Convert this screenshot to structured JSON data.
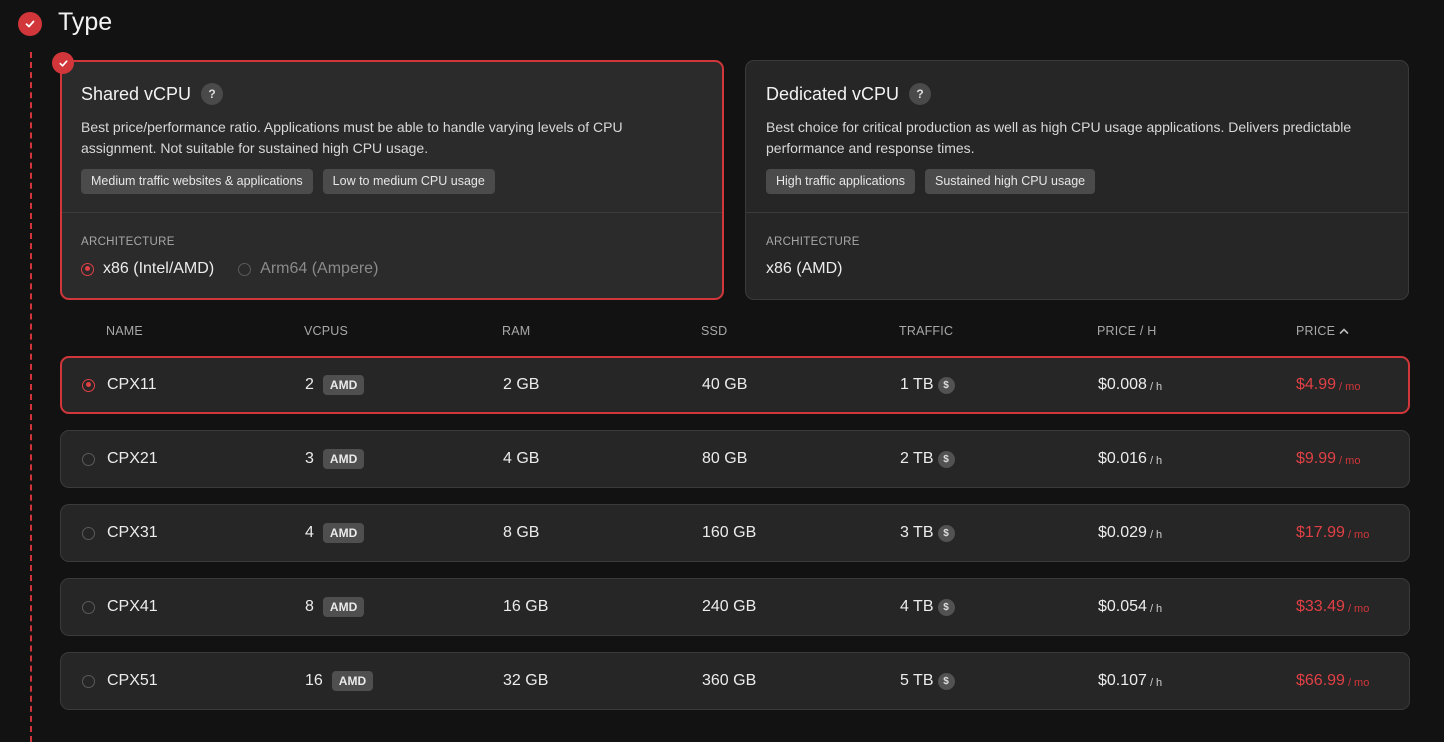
{
  "section": {
    "title": "Type"
  },
  "cards": {
    "shared": {
      "title": "Shared vCPU",
      "help": "?",
      "description": "Best price/performance ratio. Applications must be able to handle varying levels of CPU assignment. Not suitable for sustained high CPU usage.",
      "tags": [
        "Medium traffic websites & applications",
        "Low to medium CPU usage"
      ],
      "arch_label": "ARCHITECTURE",
      "arch_options": [
        {
          "label": "x86 (Intel/AMD)",
          "selected": true
        },
        {
          "label": "Arm64 (Ampere)",
          "selected": false
        }
      ]
    },
    "dedicated": {
      "title": "Dedicated vCPU",
      "help": "?",
      "description": "Best choice for critical production as well as high CPU usage applications. Delivers predictable performance and response times.",
      "tags": [
        "High traffic applications",
        "Sustained high CPU usage"
      ],
      "arch_label": "ARCHITECTURE",
      "arch_value": "x86 (AMD)"
    }
  },
  "table": {
    "headers": [
      "NAME",
      "VCPUS",
      "RAM",
      "SSD",
      "TRAFFIC",
      "PRICE / H",
      "PRICE"
    ],
    "sort_column": "PRICE",
    "rows": [
      {
        "name": "CPX11",
        "vcpus": "2",
        "badge": "AMD",
        "ram": "2 GB",
        "ssd": "40 GB",
        "traffic": "1 TB",
        "price_h": "$0.008",
        "price_h_unit": "/ h",
        "price": "$4.99",
        "price_unit": "/ mo",
        "selected": true
      },
      {
        "name": "CPX21",
        "vcpus": "3",
        "badge": "AMD",
        "ram": "4 GB",
        "ssd": "80 GB",
        "traffic": "2 TB",
        "price_h": "$0.016",
        "price_h_unit": "/ h",
        "price": "$9.99",
        "price_unit": "/ mo",
        "selected": false
      },
      {
        "name": "CPX31",
        "vcpus": "4",
        "badge": "AMD",
        "ram": "8 GB",
        "ssd": "160 GB",
        "traffic": "3 TB",
        "price_h": "$0.029",
        "price_h_unit": "/ h",
        "price": "$17.99",
        "price_unit": "/ mo",
        "selected": false
      },
      {
        "name": "CPX41",
        "vcpus": "8",
        "badge": "AMD",
        "ram": "16 GB",
        "ssd": "240 GB",
        "traffic": "4 TB",
        "price_h": "$0.054",
        "price_h_unit": "/ h",
        "price": "$33.49",
        "price_unit": "/ mo",
        "selected": false
      },
      {
        "name": "CPX51",
        "vcpus": "16",
        "badge": "AMD",
        "ram": "32 GB",
        "ssd": "360 GB",
        "traffic": "5 TB",
        "price_h": "$0.107",
        "price_h_unit": "/ h",
        "price": "$66.99",
        "price_unit": "/ mo",
        "selected": false
      }
    ]
  },
  "icons": {
    "traffic_info": "$",
    "step_check": "check-icon"
  },
  "colors": {
    "accent": "#d0363a",
    "background": "#121212",
    "card": "#262626"
  }
}
